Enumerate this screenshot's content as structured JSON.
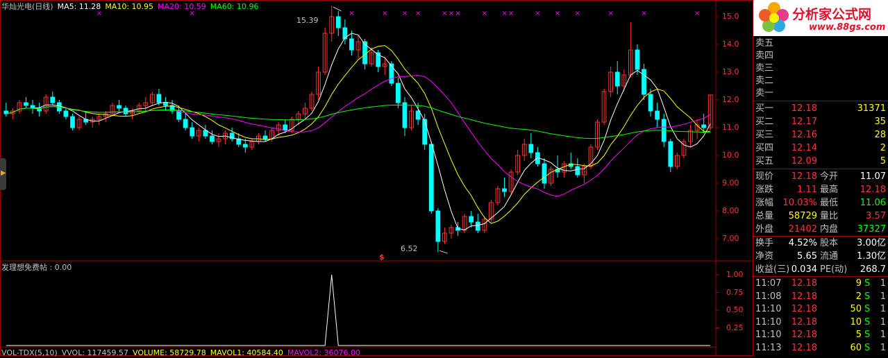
{
  "header": {
    "stock_name": "华灿光电(日线)",
    "ma5": "MA5: 11.28",
    "ma10": "MA10: 10.95",
    "ma20": "MA20: 10.59",
    "ma60": "MA60: 10.96"
  },
  "colors": {
    "up": "#ff3232",
    "down": "#00ffff",
    "ma5": "#ffffff",
    "ma10": "#ffff00",
    "ma20": "#ff00ff",
    "ma60": "#00ff00",
    "frame": "#a00000"
  },
  "price_axis": {
    "min": 6.3,
    "max": 15.5,
    "ticks": [
      "15.0",
      "14.0",
      "13.0",
      "12.0",
      "11.0",
      "10.0",
      "9.00",
      "8.00",
      "7.00"
    ]
  },
  "annotations": {
    "high_label": "15.39",
    "low_label": "6.52",
    "signal_mark": "$"
  },
  "chart_data": {
    "type": "candlestick",
    "candles": [
      [
        11.6,
        11.9,
        11.4,
        11.5
      ],
      [
        11.5,
        11.7,
        11.3,
        11.6
      ],
      [
        11.6,
        12.0,
        11.5,
        11.9
      ],
      [
        11.9,
        12.1,
        11.7,
        11.8
      ],
      [
        11.8,
        12.0,
        11.5,
        11.7
      ],
      [
        11.7,
        11.9,
        11.4,
        11.6
      ],
      [
        11.6,
        12.2,
        11.5,
        12.1
      ],
      [
        12.1,
        12.3,
        11.8,
        11.9
      ],
      [
        11.9,
        12.0,
        11.5,
        11.6
      ],
      [
        11.6,
        11.7,
        11.3,
        11.4
      ],
      [
        11.4,
        11.5,
        10.9,
        11.0
      ],
      [
        11.0,
        11.4,
        10.9,
        11.3
      ],
      [
        11.3,
        11.6,
        11.1,
        11.2
      ],
      [
        11.2,
        11.4,
        11.0,
        11.3
      ],
      [
        11.3,
        11.5,
        11.1,
        11.4
      ],
      [
        11.4,
        11.6,
        11.2,
        11.5
      ],
      [
        11.5,
        11.9,
        11.4,
        11.8
      ],
      [
        11.8,
        12.0,
        11.6,
        11.7
      ],
      [
        11.7,
        11.8,
        11.4,
        11.5
      ],
      [
        11.5,
        11.7,
        11.3,
        11.6
      ],
      [
        11.6,
        11.9,
        11.5,
        11.8
      ],
      [
        11.8,
        12.1,
        11.6,
        11.9
      ],
      [
        11.9,
        12.3,
        11.8,
        12.2
      ],
      [
        12.2,
        12.4,
        11.8,
        11.9
      ],
      [
        11.9,
        12.1,
        11.6,
        11.8
      ],
      [
        11.8,
        12.0,
        11.5,
        11.6
      ],
      [
        11.6,
        11.8,
        11.2,
        11.3
      ],
      [
        11.3,
        11.5,
        10.9,
        11.0
      ],
      [
        11.0,
        11.2,
        10.6,
        10.7
      ],
      [
        10.7,
        11.0,
        10.5,
        10.9
      ],
      [
        10.9,
        11.1,
        10.6,
        10.7
      ],
      [
        10.7,
        10.9,
        10.4,
        10.5
      ],
      [
        10.5,
        10.8,
        10.3,
        10.6
      ],
      [
        10.6,
        10.9,
        10.4,
        10.8
      ],
      [
        10.8,
        11.0,
        10.5,
        10.6
      ],
      [
        10.6,
        10.8,
        10.3,
        10.4
      ],
      [
        10.4,
        10.6,
        10.1,
        10.3
      ],
      [
        10.3,
        10.6,
        10.2,
        10.5
      ],
      [
        10.5,
        10.8,
        10.4,
        10.7
      ],
      [
        10.7,
        10.9,
        10.5,
        10.6
      ],
      [
        10.6,
        11.0,
        10.5,
        10.9
      ],
      [
        10.9,
        11.2,
        10.7,
        11.1
      ],
      [
        11.1,
        11.3,
        10.8,
        10.9
      ],
      [
        10.9,
        11.4,
        10.8,
        11.3
      ],
      [
        11.3,
        11.6,
        11.1,
        11.5
      ],
      [
        11.5,
        11.9,
        11.3,
        11.7
      ],
      [
        11.7,
        12.3,
        11.6,
        12.2
      ],
      [
        12.2,
        13.2,
        12.0,
        13.0
      ],
      [
        13.0,
        14.6,
        12.9,
        14.4
      ],
      [
        14.4,
        15.4,
        14.1,
        15.0
      ],
      [
        15.0,
        15.2,
        14.3,
        14.6
      ],
      [
        14.6,
        14.9,
        14.0,
        14.2
      ],
      [
        14.2,
        14.5,
        13.6,
        13.8
      ],
      [
        13.8,
        14.3,
        13.5,
        14.1
      ],
      [
        14.1,
        14.2,
        13.1,
        13.3
      ],
      [
        13.3,
        13.9,
        13.2,
        13.7
      ],
      [
        13.7,
        13.8,
        13.0,
        13.2
      ],
      [
        13.2,
        13.5,
        12.9,
        13.3
      ],
      [
        13.3,
        13.4,
        12.5,
        12.6
      ],
      [
        12.6,
        12.8,
        11.7,
        11.9
      ],
      [
        11.9,
        12.1,
        10.7,
        11.0
      ],
      [
        11.0,
        11.8,
        10.9,
        11.6
      ],
      [
        11.6,
        11.9,
        11.1,
        11.3
      ],
      [
        11.3,
        11.5,
        10.2,
        10.4
      ],
      [
        10.4,
        10.5,
        7.9,
        8.0
      ],
      [
        8.0,
        8.1,
        6.52,
        6.9
      ],
      [
        6.9,
        7.4,
        6.8,
        7.2
      ],
      [
        7.2,
        7.5,
        7.0,
        7.4
      ],
      [
        7.4,
        7.6,
        7.1,
        7.3
      ],
      [
        7.3,
        7.9,
        7.2,
        7.8
      ],
      [
        7.8,
        8.0,
        7.4,
        7.6
      ],
      [
        7.6,
        7.9,
        7.2,
        7.3
      ],
      [
        7.3,
        7.8,
        7.2,
        7.7
      ],
      [
        7.7,
        8.4,
        7.6,
        8.3
      ],
      [
        8.3,
        8.9,
        8.2,
        8.8
      ],
      [
        8.8,
        9.2,
        8.5,
        8.7
      ],
      [
        8.7,
        9.5,
        8.6,
        9.4
      ],
      [
        9.4,
        10.2,
        9.3,
        10.0
      ],
      [
        10.0,
        10.6,
        9.8,
        10.4
      ],
      [
        10.4,
        10.8,
        9.9,
        10.1
      ],
      [
        10.1,
        10.3,
        9.6,
        9.7
      ],
      [
        9.7,
        9.9,
        8.8,
        9.0
      ],
      [
        9.0,
        9.6,
        8.9,
        9.5
      ],
      [
        9.5,
        10.0,
        9.2,
        9.4
      ],
      [
        9.4,
        9.8,
        9.2,
        9.7
      ],
      [
        9.7,
        10.1,
        9.5,
        9.6
      ],
      [
        9.6,
        9.9,
        9.2,
        9.3
      ],
      [
        9.3,
        9.7,
        9.0,
        9.6
      ],
      [
        9.6,
        10.4,
        9.5,
        10.3
      ],
      [
        10.3,
        11.3,
        10.2,
        11.2
      ],
      [
        11.2,
        12.4,
        11.1,
        12.3
      ],
      [
        12.3,
        13.2,
        12.1,
        13.0
      ],
      [
        13.0,
        13.4,
        12.2,
        12.5
      ],
      [
        12.5,
        13.1,
        12.3,
        12.9
      ],
      [
        12.9,
        14.8,
        12.8,
        13.8
      ],
      [
        13.8,
        14.0,
        12.9,
        13.1
      ],
      [
        13.1,
        13.3,
        12.0,
        12.2
      ],
      [
        12.2,
        12.4,
        11.4,
        11.6
      ],
      [
        11.6,
        11.9,
        11.0,
        11.3
      ],
      [
        11.3,
        11.5,
        10.3,
        10.5
      ],
      [
        10.5,
        10.6,
        9.4,
        9.6
      ],
      [
        9.6,
        10.1,
        9.5,
        10.0
      ],
      [
        10.0,
        10.6,
        9.9,
        10.5
      ],
      [
        10.5,
        11.1,
        10.3,
        10.9
      ],
      [
        10.9,
        11.3,
        10.6,
        11.1
      ],
      [
        11.1,
        11.5,
        10.8,
        11.0
      ],
      [
        11.0,
        12.18,
        10.9,
        12.18
      ]
    ],
    "markers": [
      14,
      28,
      52,
      57,
      60,
      62,
      66,
      67,
      68,
      72,
      75,
      76,
      80,
      83,
      86,
      91,
      96,
      104
    ]
  },
  "indicator": {
    "title": "发理想免费帖 : 0.00",
    "ticks": [
      "1.00",
      "0.75",
      "0.50",
      "0.25"
    ],
    "spike_index": 49
  },
  "volume_bar": {
    "vol_tdx": "VOL-TDX(5,10)",
    "vvol": "VVOL: 117459.57",
    "volume": "VOLUME: 58729.78",
    "mavol1": "MAVOL1: 40584.40",
    "mavol2": "MAVOL2: 36076.00"
  },
  "logo": {
    "brand": "分析家公式网",
    "url": "www.88gs.com"
  },
  "order_book": {
    "sell": [
      {
        "label": "卖五",
        "price": "",
        "vol": ""
      },
      {
        "label": "卖四",
        "price": "",
        "vol": ""
      },
      {
        "label": "卖三",
        "price": "",
        "vol": ""
      },
      {
        "label": "卖二",
        "price": "",
        "vol": ""
      },
      {
        "label": "卖一",
        "price": "",
        "vol": ""
      }
    ],
    "buy": [
      {
        "label": "买一",
        "price": "12.18",
        "vol": "31371"
      },
      {
        "label": "买二",
        "price": "12.17",
        "vol": "35"
      },
      {
        "label": "买三",
        "price": "12.16",
        "vol": "28"
      },
      {
        "label": "买四",
        "price": "12.14",
        "vol": "2"
      },
      {
        "label": "买五",
        "price": "12.09",
        "vol": "5"
      }
    ]
  },
  "quote": {
    "rows": [
      {
        "l1": "现价",
        "v1": "12.18",
        "l2": "今开",
        "v2": "11.07"
      },
      {
        "l1": "涨跌",
        "v1": "1.11",
        "l2": "最高",
        "v2": "12.18"
      },
      {
        "l1": "涨幅",
        "v1": "10.03%",
        "l2": "最低",
        "v2": "11.06"
      },
      {
        "l1": "总量",
        "v1": "58729",
        "l2": "量比",
        "v2": "3.57"
      },
      {
        "l1": "外盘",
        "v1": "21402",
        "l2": "内盘",
        "v2": "37327"
      }
    ]
  },
  "fundamentals": {
    "rows": [
      {
        "l1": "换手",
        "v1": "4.52%",
        "l2": "股本",
        "v2": "3.00亿"
      },
      {
        "l1": "净资",
        "v1": "5.65",
        "l2": "流通",
        "v2": "1.30亿"
      },
      {
        "l1": "收益(三)",
        "v1": "0.034",
        "l2": "PE(动)",
        "v2": "268.7"
      }
    ]
  },
  "ticks": [
    {
      "time": "11:07",
      "price": "12.18",
      "vol": "9",
      "side": "S",
      "n": "1"
    },
    {
      "time": "11:08",
      "price": "12.18",
      "vol": "2",
      "side": "S",
      "n": "1"
    },
    {
      "time": "11:10",
      "price": "12.18",
      "vol": "50",
      "side": "S",
      "n": "1"
    },
    {
      "time": "11:10",
      "price": "12.18",
      "vol": "10",
      "side": "S",
      "n": "1"
    },
    {
      "time": "11:10",
      "price": "12.18",
      "vol": "5",
      "side": "S",
      "n": "1"
    },
    {
      "time": "11:13",
      "price": "12.18",
      "vol": "60",
      "side": "S",
      "n": "1"
    }
  ]
}
